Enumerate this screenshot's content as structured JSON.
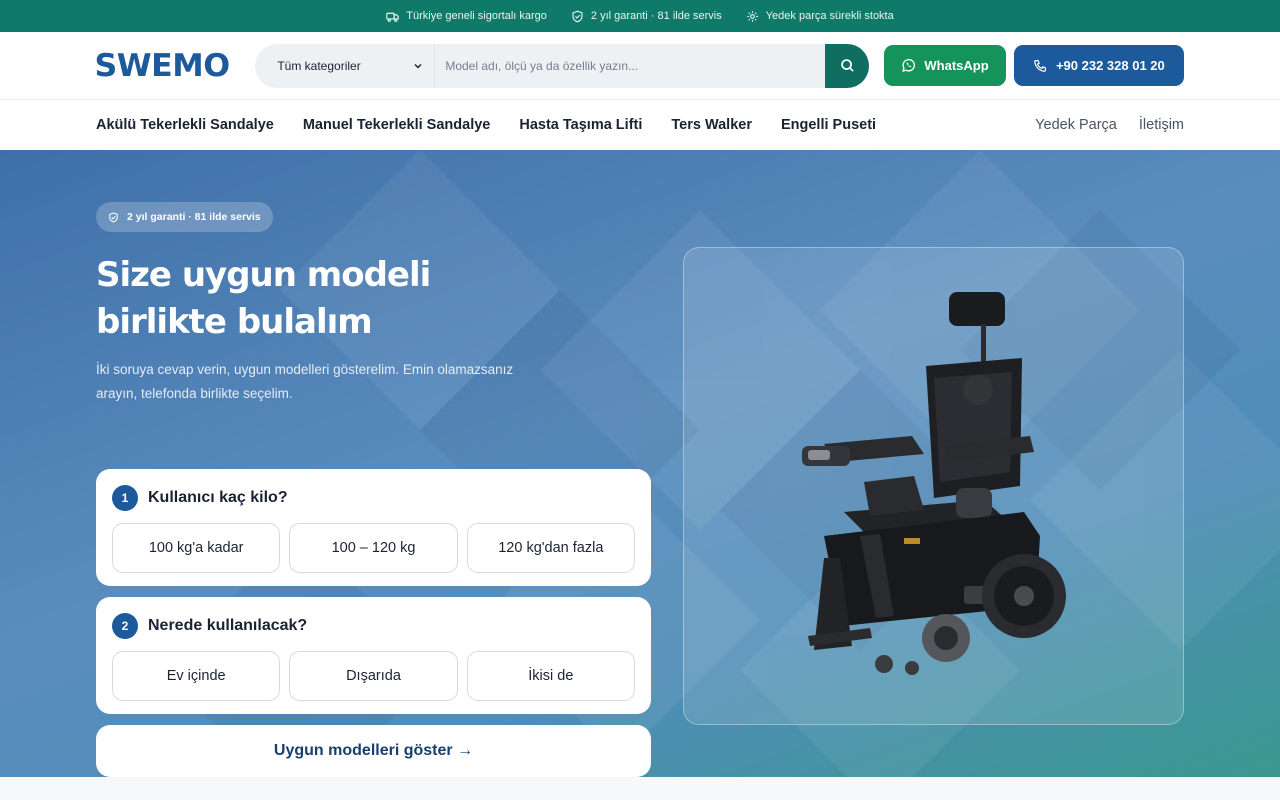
{
  "topbar": {
    "items": [
      {
        "icon": "truck-icon",
        "label": "Türkiye geneli sigortalı kargo"
      },
      {
        "icon": "shield-icon",
        "label": "2 yıl garanti · 81 ilde servis"
      },
      {
        "icon": "gear-icon",
        "label": "Yedek parça sürekli stokta"
      }
    ]
  },
  "header": {
    "logo": "SWEMO",
    "category_select": "Tüm kategoriler",
    "search_placeholder": "Model adı, ölçü ya da özellik yazın...",
    "whatsapp_label": "WhatsApp",
    "phone_label": "+90 232 328 01 20"
  },
  "nav": {
    "main": [
      "Akülü Tekerlekli Sandalye",
      "Manuel Tekerlekli Sandalye",
      "Hasta Taşıma Lifti",
      "Ters Walker",
      "Engelli Puseti"
    ],
    "right": [
      "Yedek Parça",
      "İletişim"
    ]
  },
  "hero": {
    "badge": "2 yıl garanti · 81 ilde servis",
    "title_line1": "Size uygun modeli",
    "title_line2": "birlikte bulalım",
    "subtitle": "İki soruya cevap verin, uygun modelleri gösterelim. Emin olamazsanız arayın, telefonda birlikte seçelim.",
    "question1": {
      "number": "1",
      "title": "Kullanıcı kaç kilo?",
      "options": [
        "100 kg'a kadar",
        "100 – 120 kg",
        "120 kg'dan fazla"
      ]
    },
    "question2": {
      "number": "2",
      "title": "Nerede kullanılacak?",
      "options": [
        "Ev içinde",
        "Dışarıda",
        "İkisi de"
      ]
    },
    "cta": "Uygun modelleri göster →"
  },
  "colors": {
    "topbar": "#0f7a6a",
    "brand_blue": "#1c5a9c",
    "whatsapp_green": "#14935b",
    "search_button": "#0f6e61"
  }
}
